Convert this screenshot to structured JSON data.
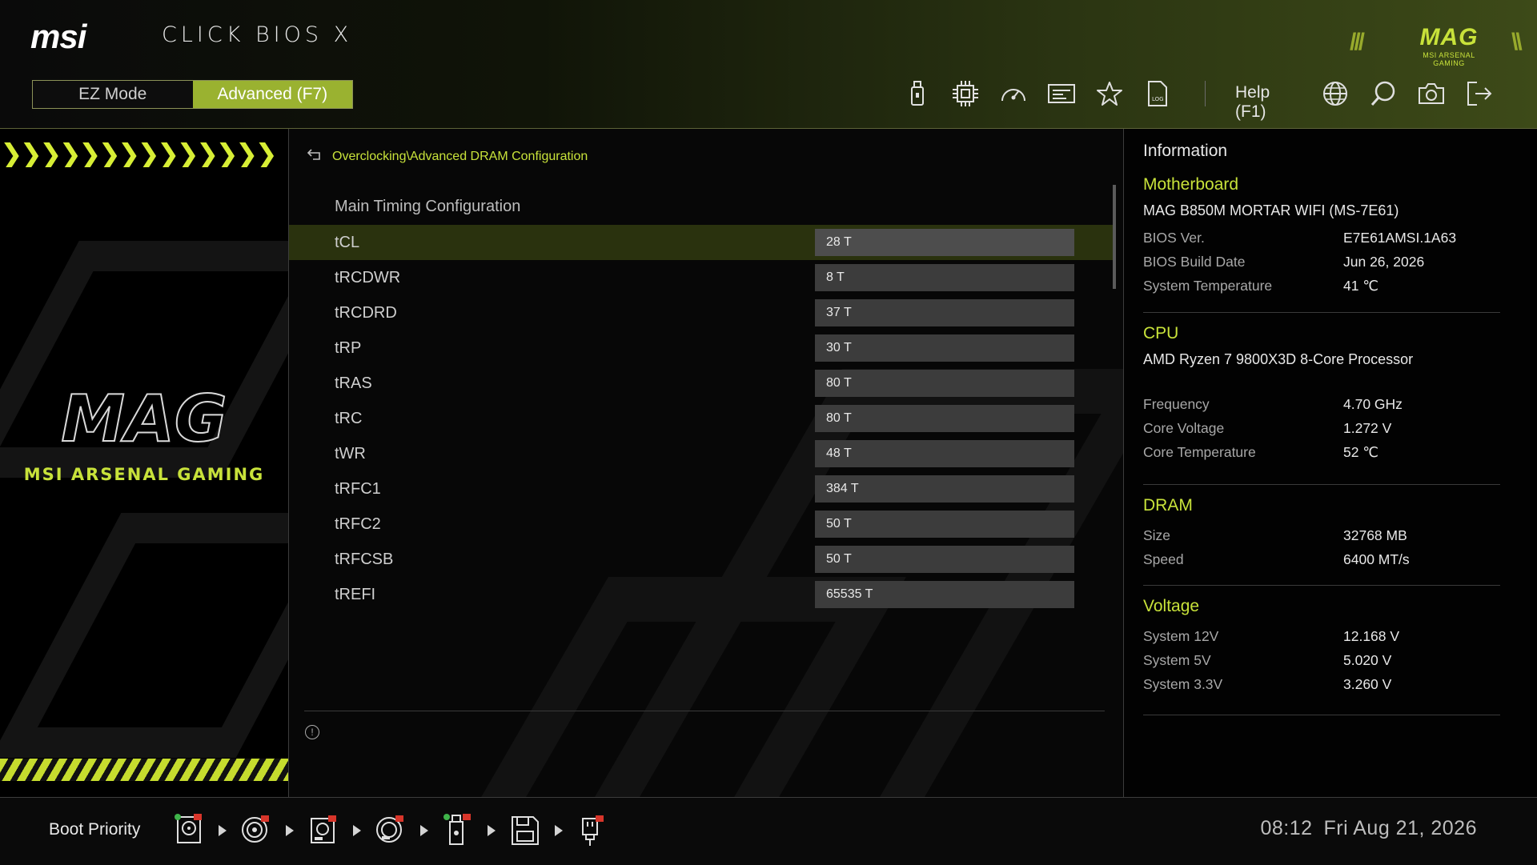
{
  "header": {
    "brand": "msi",
    "product_title": "CLICK BIOS X",
    "corner_logo": {
      "text": "MAG",
      "subtext": "MSI ARSENAL GAMING"
    },
    "modes": {
      "ez": "EZ Mode",
      "advanced": "Advanced (F7)",
      "active": "advanced"
    },
    "toolbar": {
      "icons": [
        "usb-drive-icon",
        "cpu-chip-icon",
        "speedometer-icon",
        "bios-info-icon",
        "favorite-star-icon",
        "log-file-icon"
      ],
      "help_label": "Help (F1)",
      "right_icons": [
        "language-globe-icon",
        "search-icon",
        "screenshot-camera-icon",
        "exit-icon"
      ]
    },
    "accent_color": "#c8e23a"
  },
  "left_panel": {
    "logo_text": "MAG",
    "tagline": "MSI ARSENAL GAMING"
  },
  "main": {
    "breadcrumb": "Overclocking\\Advanced DRAM Configuration",
    "section_title": "Main Timing Configuration",
    "selected_index": 0,
    "rows": [
      {
        "label": "tCL",
        "current": "28",
        "setting": "28 T"
      },
      {
        "label": "tRCDWR",
        "current": "8",
        "setting": "8 T"
      },
      {
        "label": "tRCDRD",
        "current": "37",
        "setting": "37 T"
      },
      {
        "label": "tRP",
        "current": "30",
        "setting": "30 T"
      },
      {
        "label": "tRAS",
        "current": "80",
        "setting": "80 T"
      },
      {
        "label": "tRC",
        "current": "80",
        "setting": "80 T"
      },
      {
        "label": "tWR",
        "current": "48",
        "setting": "48 T"
      },
      {
        "label": "tRFC1",
        "current": "384",
        "setting": "384 T"
      },
      {
        "label": "tRFC2",
        "current": "50",
        "setting": "50 T"
      },
      {
        "label": "tRFCSB",
        "current": "50",
        "setting": "50 T"
      },
      {
        "label": "tREFI",
        "current": "65535",
        "setting": "65535 T"
      }
    ],
    "info_icon": "info-circle-icon"
  },
  "info": {
    "title": "Information",
    "motherboard": {
      "title": "Motherboard",
      "model": "MAG B850M MORTAR WIFI (MS-7E61)",
      "bios_ver_label": "BIOS Ver.",
      "bios_ver": "E7E61AMSI.1A63",
      "bios_date_label": "BIOS Build Date",
      "bios_date": "Jun 26, 2026",
      "sys_temp_label": "System Temperature",
      "sys_temp": "41 ℃"
    },
    "cpu": {
      "title": "CPU",
      "model": "AMD Ryzen 7 9800X3D 8-Core Processor",
      "freq_label": "Frequency",
      "freq": "4.70 GHz",
      "voltage_label": "Core Voltage",
      "voltage": "1.272 V",
      "temp_label": "Core Temperature",
      "temp": "52 ℃"
    },
    "dram": {
      "title": "DRAM",
      "size_label": "Size",
      "size": "32768 MB",
      "speed_label": "Speed",
      "speed": "6400 MT/s"
    },
    "voltage": {
      "title": "Voltage",
      "v12_label": "System 12V",
      "v12": "12.168 V",
      "v5_label": "System 5V",
      "v5": "5.020 V",
      "v33_label": "System 3.3V",
      "v33": "3.260 V"
    }
  },
  "footer": {
    "boot_priority_label": "Boot Priority",
    "boot_devices": [
      "hdd-icon",
      "optical-disc-icon",
      "ssd-icon",
      "optical-disc-icon",
      "usb-key-icon",
      "floppy-icon",
      "usb-device-icon"
    ],
    "time": "08:12",
    "date": "Fri Aug 21, 2026"
  }
}
